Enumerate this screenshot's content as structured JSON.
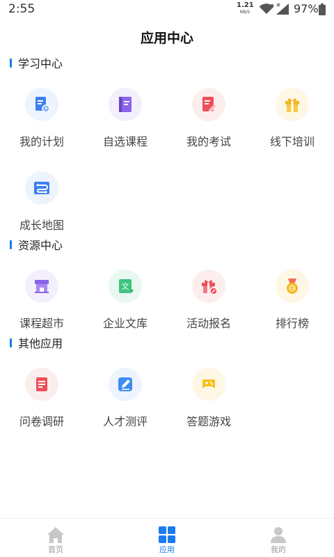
{
  "status_bar": {
    "time": "2:55",
    "net_speed_value": "1.21",
    "net_speed_unit": "KB/S",
    "battery_percent": "97%"
  },
  "page_title": "应用中心",
  "sections": [
    {
      "title": "学习中心",
      "items": [
        {
          "label": "我的计划",
          "icon": "plan-icon"
        },
        {
          "label": "自选课程",
          "icon": "course-book-icon"
        },
        {
          "label": "我的考试",
          "icon": "exam-icon"
        },
        {
          "label": "线下培训",
          "icon": "gift-icon"
        },
        {
          "label": "成长地图",
          "icon": "map-icon"
        }
      ]
    },
    {
      "title": "资源中心",
      "items": [
        {
          "label": "课程超市",
          "icon": "store-icon"
        },
        {
          "label": "企业文库",
          "icon": "library-icon"
        },
        {
          "label": "活动报名",
          "icon": "activity-gift-icon"
        },
        {
          "label": "排行榜",
          "icon": "medal-icon"
        }
      ]
    },
    {
      "title": "其他应用",
      "items": [
        {
          "label": "问卷调研",
          "icon": "survey-icon"
        },
        {
          "label": "人才测评",
          "icon": "edit-icon"
        },
        {
          "label": "答题游戏",
          "icon": "gamepad-icon"
        }
      ]
    }
  ],
  "bottom_nav": [
    {
      "label": "首页",
      "icon": "home-icon",
      "active": false
    },
    {
      "label": "应用",
      "icon": "apps-grid-icon",
      "active": true
    },
    {
      "label": "我的",
      "icon": "profile-icon",
      "active": false
    }
  ],
  "colors": {
    "accent": "#1a7af0",
    "inactive_nav": "#999999"
  }
}
